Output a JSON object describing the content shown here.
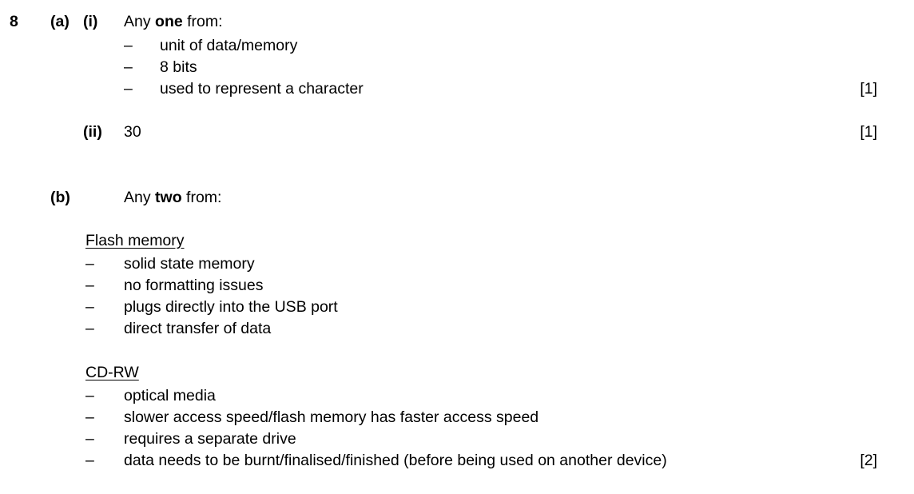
{
  "question": {
    "number": "8",
    "parts": [
      {
        "label": "(a)",
        "subparts": [
          {
            "label": "(i)",
            "stem_before": "Any ",
            "stem_emphasis": "one",
            "stem_after": " from:",
            "bullets": [
              "unit of data/memory",
              "8 bits",
              "used to represent a character"
            ],
            "marks": "[1]"
          },
          {
            "label": "(ii)",
            "answer": "30",
            "marks": "[1]"
          }
        ]
      },
      {
        "label": "(b)",
        "stem_before": "Any ",
        "stem_emphasis": "two",
        "stem_after": " from:",
        "groups": [
          {
            "heading": "Flash memory",
            "bullets": [
              "solid state memory",
              "no formatting issues",
              "plugs directly into the USB port",
              "direct transfer of data"
            ]
          },
          {
            "heading": "CD-RW",
            "bullets": [
              "optical media",
              "slower access speed/flash memory has faster access speed",
              "requires a separate drive",
              "data needs to be burnt/finalised/finished (before being used on another device)"
            ]
          }
        ],
        "marks": "[2]"
      }
    ],
    "bullet_marker": "–"
  }
}
